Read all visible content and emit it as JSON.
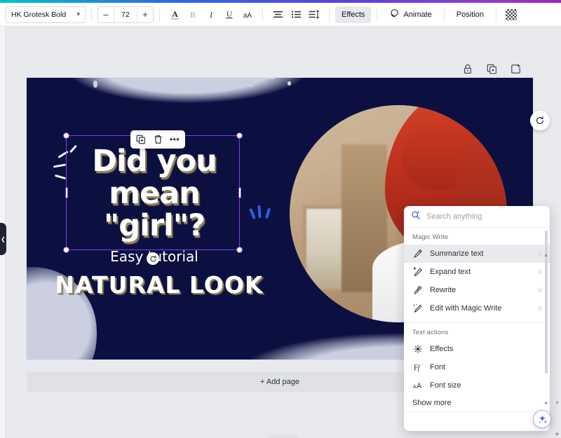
{
  "toolbar": {
    "font_family": "HK Grotesk Bold",
    "font_size": "72",
    "decrease_label": "–",
    "increase_label": "+",
    "text_color_label": "A",
    "bold_label": "B",
    "italic_label": "I",
    "underline_label": "U",
    "case_label": "aA",
    "effects_label": "Effects",
    "animate_label": "Animate",
    "position_label": "Position",
    "transparency_name": "transparency-icon"
  },
  "page_actions": {
    "lock": "lock-icon",
    "duplicate": "duplicate-icon",
    "export": "add-to-folder-icon"
  },
  "design": {
    "title": "Did you mean \"girl\"?",
    "title_lines": [
      "Did you",
      "mean",
      "\"girl\"?"
    ],
    "subtitle": "Easy tutorial",
    "headline": "NATURAL LOOK",
    "background_color": "#0c1040",
    "splatter_color": "#cbcfe0",
    "accent_blue": "#2f5fe0",
    "selection_color": "#7b3ff2"
  },
  "float_toolbar": {
    "duplicate_label": "duplicate-icon",
    "delete_label": "trash-icon",
    "more_label": "•••"
  },
  "canvas_bottom": {
    "add_page_label": "+ Add page"
  },
  "panel": {
    "search_placeholder": "Search anything",
    "search_value": "",
    "groups": [
      {
        "label": "Magic Write",
        "items": [
          {
            "label": "Summarize text",
            "icon": "pen-summarize-icon",
            "premium": true,
            "highlighted": true
          },
          {
            "label": "Expand text",
            "icon": "pen-expand-icon",
            "premium": true,
            "highlighted": false
          },
          {
            "label": "Rewrite",
            "icon": "pen-rewrite-icon",
            "premium": true,
            "highlighted": false
          },
          {
            "label": "Edit with Magic Write",
            "icon": "magic-wand-icon",
            "premium": true,
            "highlighted": false
          }
        ]
      },
      {
        "label": "Text actions",
        "items": [
          {
            "label": "Effects",
            "icon": "sparkle-effects-icon",
            "premium": false,
            "highlighted": false
          },
          {
            "label": "Font",
            "icon": "font-icon",
            "premium": false,
            "highlighted": false
          },
          {
            "label": "Font size",
            "icon": "font-size-icon",
            "premium": false,
            "highlighted": false
          }
        ]
      }
    ],
    "show_more_label": "Show more",
    "crown_glyph": "♛"
  },
  "fabs": {
    "regenerate": "regenerate-icon",
    "ai_assistant": "sparkle-ai-icon"
  }
}
